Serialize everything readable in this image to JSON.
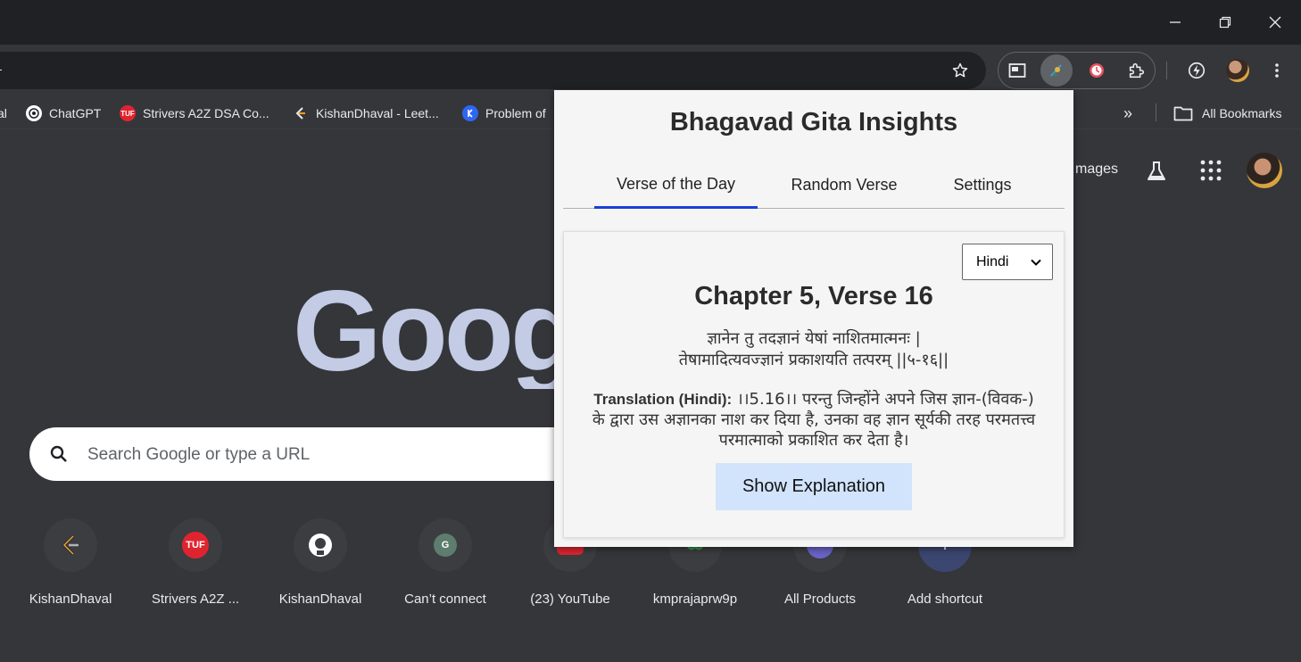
{
  "window": {
    "minimize_icon": "minimize-icon",
    "restore_icon": "restore-icon",
    "close_icon": "close-icon"
  },
  "toolbar": {
    "star_icon": "star-icon",
    "extensions": [
      "side-panel-icon",
      "gita-extension-icon",
      "timer-extension-icon",
      "extensions-puzzle-icon"
    ],
    "performance_icon": "performance-icon",
    "menu_icon": "kebab-menu-icon"
  },
  "bookmarks": {
    "items": [
      {
        "label": "al",
        "icon": "bookmark-icon"
      },
      {
        "label": "ChatGPT",
        "icon": "chatgpt-icon"
      },
      {
        "label": "Strivers A2Z DSA Co...",
        "icon": "tuf-icon",
        "icon_text": "TUF"
      },
      {
        "label": "KishanDhaval - Leet...",
        "icon": "leetcode-icon"
      },
      {
        "label": "Problem of",
        "icon": "codechef-icon"
      }
    ],
    "overflow_label": "»",
    "all_bookmarks_label": "All Bookmarks"
  },
  "ntp": {
    "logo_text": "Google",
    "search_placeholder": "Search Google or type a URL",
    "images_link": "mages",
    "shortcuts": [
      {
        "label": "KishanDhaval",
        "icon": "leetcode-icon",
        "icon_text": ""
      },
      {
        "label": "Strivers A2Z ...",
        "icon": "tuf-icon",
        "icon_text": "TUF"
      },
      {
        "label": "KishanDhaval",
        "icon": "github-icon",
        "icon_text": ""
      },
      {
        "label": "Can’t connect",
        "icon": "letter-g-icon",
        "icon_text": "G"
      },
      {
        "label": "(23) YouTube",
        "icon": "youtube-icon",
        "icon_text": ""
      },
      {
        "label": "kmprajaprw9p",
        "icon": "link-icon",
        "icon_text": ""
      },
      {
        "label": "All Products",
        "icon": "products-icon",
        "icon_text": ""
      },
      {
        "label": "Add shortcut",
        "icon": "plus-icon",
        "icon_text": "+"
      }
    ]
  },
  "popup": {
    "title": "Bhagavad Gita Insights",
    "tabs": [
      {
        "label": "Verse of the Day",
        "active": true
      },
      {
        "label": "Random Verse",
        "active": false
      },
      {
        "label": "Settings",
        "active": false
      }
    ],
    "language": "Hindi",
    "verse_heading": "Chapter 5, Verse 16",
    "sanskrit_line1": "ज्ञानेन तु तदज्ञानं येषां नाशितमात्मनः |",
    "sanskrit_line2": "तेषामादित्यवज्ज्ञानं प्रकाशयति तत्परम् ||५-१६||",
    "translation_label": "Translation (Hindi):",
    "translation_text": " ।।5.16।। परन्तु जिन्होंने अपने जिस ज्ञान-(विवक-) के द्वारा उस अज्ञानका नाश कर दिया है, उनका वह ज्ञान सूर्यकी तरह परमतत्त्व परमात्माको प्रकाशित कर देता है।",
    "explain_button": "Show Explanation",
    "accent_color": "#1a3ed6",
    "button_color": "#d2e3fc"
  }
}
